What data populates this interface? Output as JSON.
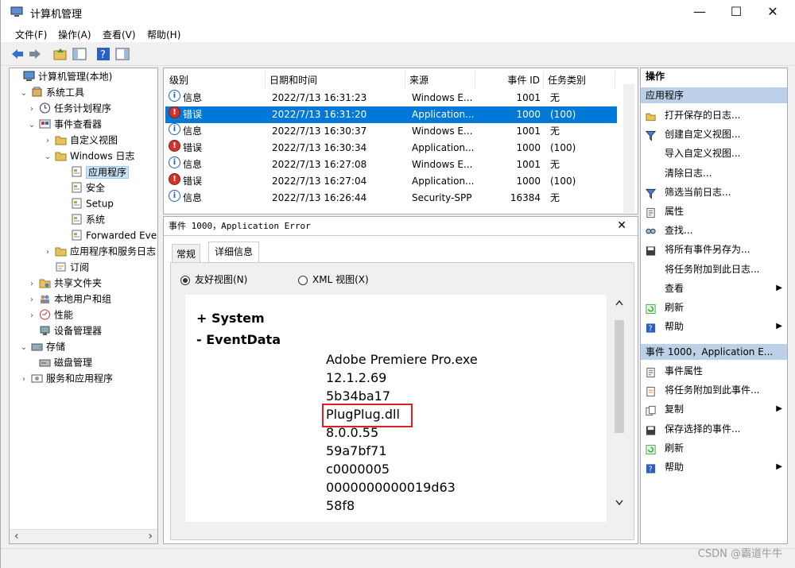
{
  "window": {
    "title": "计算机管理",
    "min": "—",
    "max": "☐",
    "close": "✕"
  },
  "menu": [
    "文件(F)",
    "操作(A)",
    "查看(V)",
    "帮助(H)"
  ],
  "tree": {
    "items": [
      {
        "label": "计算机管理(本地)",
        "icon": "computer-icon",
        "expand": ""
      },
      {
        "label": "系统工具",
        "icon": "tools-icon",
        "expand": "⌄"
      },
      {
        "label": "任务计划程序",
        "icon": "clock-icon",
        "expand": "›"
      },
      {
        "label": "事件查看器",
        "icon": "event-viewer-icon",
        "expand": "⌄"
      },
      {
        "label": "自定义视图",
        "icon": "folder-icon",
        "expand": "›"
      },
      {
        "label": "Windows 日志",
        "icon": "folder-icon",
        "expand": "⌄"
      },
      {
        "label": "应用程序",
        "icon": "log-icon",
        "expand": ""
      },
      {
        "label": "安全",
        "icon": "log-icon",
        "expand": ""
      },
      {
        "label": "Setup",
        "icon": "log-icon",
        "expand": ""
      },
      {
        "label": "系统",
        "icon": "log-icon",
        "expand": ""
      },
      {
        "label": "Forwarded Eve",
        "icon": "log-icon",
        "expand": ""
      },
      {
        "label": "应用程序和服务日志",
        "icon": "folder-icon",
        "expand": "›"
      },
      {
        "label": "订阅",
        "icon": "subscription-icon",
        "expand": ""
      },
      {
        "label": "共享文件夹",
        "icon": "shared-folder-icon",
        "expand": "›"
      },
      {
        "label": "本地用户和组",
        "icon": "users-icon",
        "expand": "›"
      },
      {
        "label": "性能",
        "icon": "performance-icon",
        "expand": "›"
      },
      {
        "label": "设备管理器",
        "icon": "device-manager-icon",
        "expand": ""
      },
      {
        "label": "存储",
        "icon": "storage-icon",
        "expand": "⌄"
      },
      {
        "label": "磁盘管理",
        "icon": "disk-icon",
        "expand": ""
      },
      {
        "label": "服务和应用程序",
        "icon": "services-icon",
        "expand": "›"
      }
    ]
  },
  "events": {
    "headers": [
      "级别",
      "日期和时间",
      "来源",
      "事件 ID",
      "任务类别"
    ],
    "rows": [
      {
        "level": "信息",
        "type": "info",
        "date": "2022/7/13 16:31:23",
        "source": "Windows E...",
        "id": "1001",
        "cat": "无"
      },
      {
        "level": "错误",
        "type": "error",
        "date": "2022/7/13 16:31:20",
        "source": "Application...",
        "id": "1000",
        "cat": "(100)"
      },
      {
        "level": "信息",
        "type": "info",
        "date": "2022/7/13 16:30:37",
        "source": "Windows E...",
        "id": "1001",
        "cat": "无"
      },
      {
        "level": "错误",
        "type": "error",
        "date": "2022/7/13 16:30:34",
        "source": "Application...",
        "id": "1000",
        "cat": "(100)"
      },
      {
        "level": "信息",
        "type": "info",
        "date": "2022/7/13 16:27:08",
        "source": "Windows E...",
        "id": "1001",
        "cat": "无"
      },
      {
        "level": "错误",
        "type": "error",
        "date": "2022/7/13 16:27:04",
        "source": "Application...",
        "id": "1000",
        "cat": "(100)"
      },
      {
        "level": "信息",
        "type": "info",
        "date": "2022/7/13 16:26:44",
        "source": "Security-SPP",
        "id": "16384",
        "cat": "无"
      }
    ]
  },
  "detail": {
    "title": "事件 1000，Application Error",
    "close": "✕",
    "tabs": [
      "常规",
      "详细信息"
    ],
    "radio_friendly": "友好视图(N)",
    "radio_xml": "XML 视图(X)",
    "system_label": "+  System",
    "eventdata_label": "-  EventData",
    "values": [
      "Adobe Premiere Pro.exe",
      "12.1.2.69",
      "5b34ba17",
      "PlugPlug.dll",
      "8.0.0.55",
      "59a7bf71",
      "c0000005",
      "0000000000019d63",
      "58f8"
    ]
  },
  "actions": {
    "header": "操作",
    "group1": "应用程序",
    "group1_items": [
      {
        "label": "打开保存的日志...",
        "icon": "open-log-icon",
        "arrow": ""
      },
      {
        "label": "创建自定义视图...",
        "icon": "filter-icon",
        "arrow": ""
      },
      {
        "label": "导入自定义视图...",
        "icon": "",
        "arrow": ""
      },
      {
        "label": "清除日志...",
        "icon": "",
        "arrow": ""
      },
      {
        "label": "筛选当前日志...",
        "icon": "filter-icon",
        "arrow": ""
      },
      {
        "label": "属性",
        "icon": "properties-icon",
        "arrow": ""
      },
      {
        "label": "查找...",
        "icon": "find-icon",
        "arrow": ""
      },
      {
        "label": "将所有事件另存为...",
        "icon": "save-icon",
        "arrow": ""
      },
      {
        "label": "将任务附加到此日志...",
        "icon": "",
        "arrow": ""
      },
      {
        "label": "查看",
        "icon": "",
        "arrow": "▶"
      },
      {
        "label": "刷新",
        "icon": "refresh-icon",
        "arrow": ""
      },
      {
        "label": "帮助",
        "icon": "help-icon",
        "arrow": "▶"
      }
    ],
    "group2": "事件 1000，Application E...",
    "group2_items": [
      {
        "label": "事件属性",
        "icon": "properties-icon",
        "arrow": ""
      },
      {
        "label": "将任务附加到此事件...",
        "icon": "attach-icon",
        "arrow": ""
      },
      {
        "label": "复制",
        "icon": "copy-icon",
        "arrow": "▶"
      },
      {
        "label": "保存选择的事件...",
        "icon": "save-icon",
        "arrow": ""
      },
      {
        "label": "刷新",
        "icon": "refresh-icon",
        "arrow": ""
      },
      {
        "label": "帮助",
        "icon": "help-icon",
        "arrow": "▶"
      }
    ]
  },
  "watermark": "CSDN @霸道牛牛",
  "colors": {
    "selection": "#0078d7",
    "info": "#1f5fb4",
    "error": "#d0342c",
    "highlight_box": "#e02020",
    "action_group": "#bcd0e8"
  }
}
